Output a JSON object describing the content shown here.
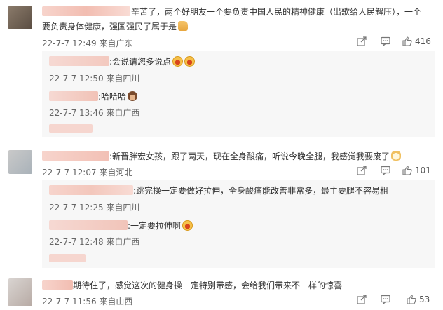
{
  "comments": [
    {
      "text_line1": "辛苦了，两个好朋友一个要负责中国人民的精神健康（出歌给人民解压），一个",
      "text_line2": "要负责身体健康，强国强民了属于是",
      "emoji": "thumbs-up",
      "meta": "22-7-7 12:49 来自广东",
      "likes": "416",
      "replies": [
        {
          "text": ":会说请您多说点",
          "emoji": "laughing-crying",
          "meta": "22-7-7 12:50 来自四川"
        },
        {
          "text": ":哈哈哈",
          "emoji": "monkey",
          "meta": "22-7-7 13:46 来自广西"
        }
      ]
    },
    {
      "text_line1": ":新晋胖宏女孩，跟了两天，现在全身酸痛，听说今晚全腿，我感觉我要废了",
      "emoji": "cat",
      "meta": "22-7-7 12:07 来自河北",
      "likes": "101",
      "replies": [
        {
          "text": ":跳完操一定要做好拉伸，全身酸痛能改善非常多，最主要腿不容易粗",
          "meta": "22-7-7 12:25 来自四川"
        },
        {
          "text": ":一定要拉伸啊",
          "emoji": "laughing-crying",
          "meta": "22-7-7 12:48 来自广西"
        }
      ]
    },
    {
      "text_line1": "期待住了，感觉这次的健身操一定特别带感，会给我们带来不一样的惊喜",
      "meta": "22-7-7 11:56 来自山西",
      "likes": "53"
    }
  ],
  "icons": {
    "share": "share-icon",
    "comment": "comment-icon",
    "like": "thumbs-up-icon"
  }
}
